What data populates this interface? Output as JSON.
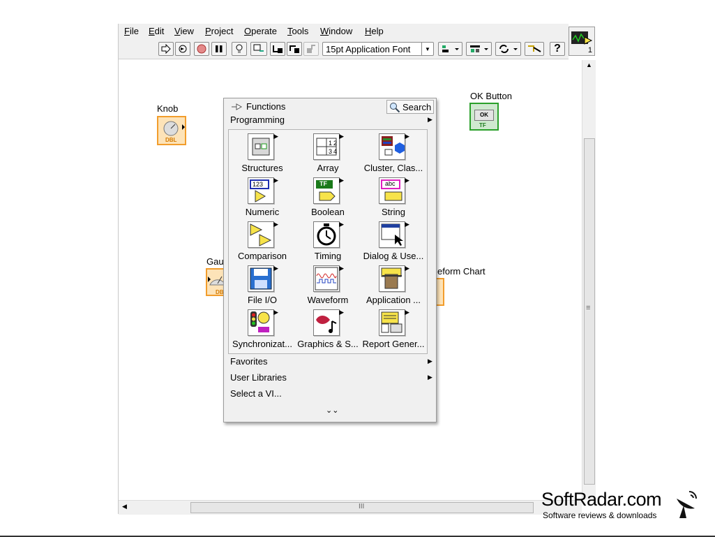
{
  "menu": [
    {
      "accel": "F",
      "rest": "ile"
    },
    {
      "accel": "E",
      "rest": "dit"
    },
    {
      "accel": "V",
      "rest": "iew"
    },
    {
      "accel": "P",
      "rest": "roject"
    },
    {
      "accel": "O",
      "rest": "perate"
    },
    {
      "accel": "T",
      "rest": "ools"
    },
    {
      "accel": "W",
      "rest": "indow"
    },
    {
      "accel": "H",
      "rest": "elp"
    }
  ],
  "toolbar": {
    "font": "15pt Application Font",
    "help": "?"
  },
  "diagram": {
    "knob_label": "Knob",
    "knob_tag": "DBL",
    "ok_label": "OK Button",
    "ok_text": "OK",
    "ok_tag": "TF",
    "gauge_label": "Gau",
    "gauge_tag": "DBL",
    "chart_label": "eform Chart"
  },
  "palette": {
    "title": "Functions",
    "search": "Search",
    "category": "Programming",
    "items": [
      {
        "label": "Structures",
        "icon": "structures-icon"
      },
      {
        "label": "Array",
        "icon": "array-icon"
      },
      {
        "label": "Cluster, Clas...",
        "icon": "cluster-icon"
      },
      {
        "label": "Numeric",
        "icon": "numeric-icon"
      },
      {
        "label": "Boolean",
        "icon": "boolean-icon"
      },
      {
        "label": "String",
        "icon": "string-icon"
      },
      {
        "label": "Comparison",
        "icon": "comparison-icon"
      },
      {
        "label": "Timing",
        "icon": "timing-icon"
      },
      {
        "label": "Dialog & Use...",
        "icon": "dialog-icon"
      },
      {
        "label": "File I/O",
        "icon": "file-io-icon"
      },
      {
        "label": "Waveform",
        "icon": "waveform-icon"
      },
      {
        "label": "Application ...",
        "icon": "application-control-icon"
      },
      {
        "label": "Synchronizat...",
        "icon": "synchronization-icon"
      },
      {
        "label": "Graphics & S...",
        "icon": "graphics-sound-icon"
      },
      {
        "label": "Report Gener...",
        "icon": "report-generation-icon"
      }
    ],
    "favorites": "Favorites",
    "user_libraries": "User Libraries",
    "select_vi": "Select a VI...",
    "array_digits": [
      "1",
      "2",
      "3",
      "4"
    ],
    "numeric_digits": "123",
    "boolean_text": "TF",
    "string_text": "abc"
  },
  "watermark": {
    "main": "SoftRadar.com",
    "sub": "Software reviews & downloads"
  },
  "hscroll_grip": "III",
  "vscroll_grip": "≡",
  "vi_icon_num": "1"
}
